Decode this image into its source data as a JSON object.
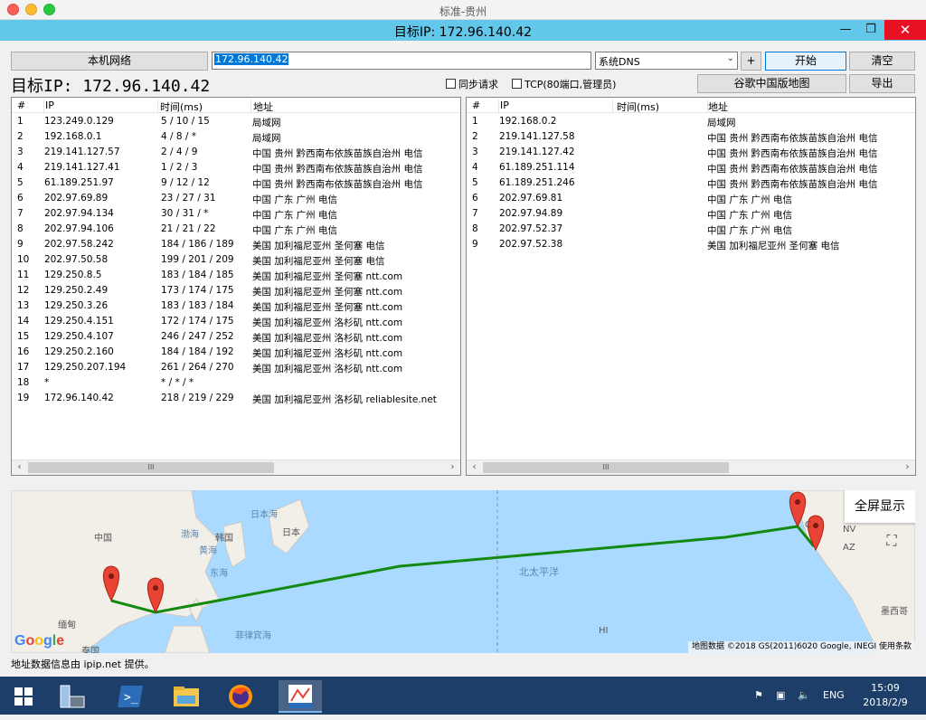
{
  "window": {
    "title": "标准-贵州",
    "target_title": "目标IP: 172.96.140.42",
    "minimize": "—",
    "maximize": "❐",
    "close": "✕"
  },
  "toolbar": {
    "local_net": "本机网络",
    "ip_value": "172.96.140.42",
    "dns_value": "系统DNS",
    "dns_arrow": "⌄",
    "plus": "+",
    "start": "开始",
    "clear": "清空",
    "target_big": "目标IP: 172.96.140.42",
    "sync_req": "同步请求",
    "tcp": "TCP(80端口,管理员)",
    "google_map": "谷歌中国版地图",
    "export": "导出"
  },
  "columns": {
    "num": "#",
    "ip": "IP",
    "time": "时间(ms)",
    "addr": "地址"
  },
  "left_rows": [
    {
      "n": "1",
      "ip": "123.249.0.129",
      "t": "5 / 10 / 15",
      "a": "局域网"
    },
    {
      "n": "2",
      "ip": "192.168.0.1",
      "t": "4 / 8 / *",
      "a": "局域网"
    },
    {
      "n": "3",
      "ip": "219.141.127.57",
      "t": "2 / 4 / 9",
      "a": "中国 贵州 黔西南布依族苗族自治州 电信"
    },
    {
      "n": "4",
      "ip": "219.141.127.41",
      "t": "1 / 2 / 3",
      "a": "中国 贵州 黔西南布依族苗族自治州 电信"
    },
    {
      "n": "5",
      "ip": "61.189.251.97",
      "t": "9 / 12 / 12",
      "a": "中国 贵州 黔西南布依族苗族自治州 电信"
    },
    {
      "n": "6",
      "ip": "202.97.69.89",
      "t": "23 / 27 / 31",
      "a": "中国 广东 广州 电信"
    },
    {
      "n": "7",
      "ip": "202.97.94.134",
      "t": "30 / 31 / *",
      "a": "中国 广东 广州 电信"
    },
    {
      "n": "8",
      "ip": "202.97.94.106",
      "t": "21 / 21 / 22",
      "a": "中国 广东 广州 电信"
    },
    {
      "n": "9",
      "ip": "202.97.58.242",
      "t": "184 / 186 / 189",
      "a": "美国 加利福尼亚州 圣何塞 电信"
    },
    {
      "n": "10",
      "ip": "202.97.50.58",
      "t": "199 / 201 / 209",
      "a": "美国 加利福尼亚州 圣何塞 电信"
    },
    {
      "n": "11",
      "ip": "129.250.8.5",
      "t": "183 / 184 / 185",
      "a": "美国 加利福尼亚州 圣何塞 ntt.com"
    },
    {
      "n": "12",
      "ip": "129.250.2.49",
      "t": "173 / 174 / 175",
      "a": "美国 加利福尼亚州 圣何塞 ntt.com"
    },
    {
      "n": "13",
      "ip": "129.250.3.26",
      "t": "183 / 183 / 184",
      "a": "美国 加利福尼亚州 圣何塞 ntt.com"
    },
    {
      "n": "14",
      "ip": "129.250.4.151",
      "t": "172 / 174 / 175",
      "a": "美国 加利福尼亚州 洛杉矶 ntt.com"
    },
    {
      "n": "15",
      "ip": "129.250.4.107",
      "t": "246 / 247 / 252",
      "a": "美国 加利福尼亚州 洛杉矶 ntt.com"
    },
    {
      "n": "16",
      "ip": "129.250.2.160",
      "t": "184 / 184 / 192",
      "a": "美国 加利福尼亚州 洛杉矶 ntt.com"
    },
    {
      "n": "17",
      "ip": "129.250.207.194",
      "t": "261 / 264 / 270",
      "a": "美国 加利福尼亚州 洛杉矶 ntt.com"
    },
    {
      "n": "18",
      "ip": "*",
      "t": "* / * / *",
      "a": ""
    },
    {
      "n": "19",
      "ip": "172.96.140.42",
      "t": "218 / 219 / 229",
      "a": "美国 加利福尼亚州 洛杉矶 reliablesite.net"
    }
  ],
  "right_rows": [
    {
      "n": "1",
      "ip": "192.168.0.2",
      "t": "",
      "a": "局域网"
    },
    {
      "n": "2",
      "ip": "219.141.127.58",
      "t": "",
      "a": "中国 贵州 黔西南布依族苗族自治州 电信"
    },
    {
      "n": "3",
      "ip": "219.141.127.42",
      "t": "",
      "a": "中国 贵州 黔西南布依族苗族自治州 电信"
    },
    {
      "n": "4",
      "ip": "61.189.251.114",
      "t": "",
      "a": "中国 贵州 黔西南布依族苗族自治州 电信"
    },
    {
      "n": "5",
      "ip": "61.189.251.246",
      "t": "",
      "a": "中国 贵州 黔西南布依族苗族自治州 电信"
    },
    {
      "n": "6",
      "ip": "202.97.69.81",
      "t": "",
      "a": "中国 广东 广州 电信"
    },
    {
      "n": "7",
      "ip": "202.97.94.89",
      "t": "",
      "a": "中国 广东 广州 电信"
    },
    {
      "n": "8",
      "ip": "202.97.52.37",
      "t": "",
      "a": "中国 广东 广州 电信"
    },
    {
      "n": "9",
      "ip": "202.97.52.38",
      "t": "",
      "a": "美国 加利福尼亚州 圣何塞 电信"
    }
  ],
  "scroll": {
    "left": "‹",
    "right": "›",
    "thumb": "III"
  },
  "map": {
    "fullscreen": "全屏显示",
    "fs_icon": "⛶",
    "credit": "地图数据 ©2018 GS(2011)6020 Google, INEGI   使用条款",
    "google": "Google",
    "labels": {
      "china": "中国",
      "korea": "韩国",
      "japan": "日本",
      "bohai": "渤海",
      "yellow_sea": "黄海",
      "east_sea": "东海",
      "sea_of_japan": "日本海",
      "north_pacific": "北太平洋",
      "philippine_sea": "菲律宾海",
      "myanmar": "缅甸",
      "thailand": "泰国",
      "nv": "NV",
      "az": "AZ",
      "mexico": "墨西哥",
      "hi": "HI",
      "c": "C"
    }
  },
  "footer": "地址数据信息由 ipip.net 提供。",
  "taskbar": {
    "lang": "ENG",
    "time": "15:09",
    "date": "2018/2/9"
  }
}
